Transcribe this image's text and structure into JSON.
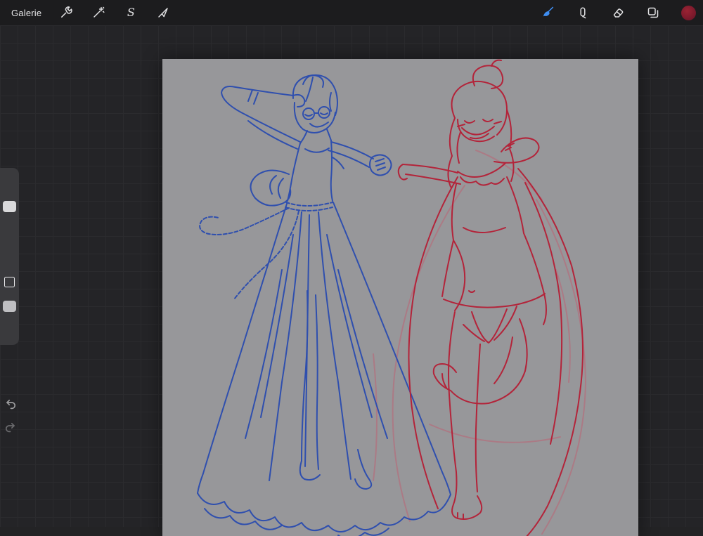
{
  "topbar": {
    "gallery_label": "Galerie",
    "tools_left": [
      {
        "name": "actions",
        "icon": "wrench-icon"
      },
      {
        "name": "adjustments",
        "icon": "magic-wand-icon"
      },
      {
        "name": "selection",
        "icon": "selection-s-icon",
        "glyph": "S"
      },
      {
        "name": "transform",
        "icon": "transform-arrow-icon"
      }
    ],
    "tools_right": [
      {
        "name": "paint",
        "icon": "brush-icon",
        "active": true
      },
      {
        "name": "smudge",
        "icon": "smudge-icon"
      },
      {
        "name": "erase",
        "icon": "eraser-icon"
      },
      {
        "name": "layers",
        "icon": "layers-icon"
      },
      {
        "name": "color",
        "icon": "color-swatch",
        "swatch_color": "#8a1c2b"
      }
    ],
    "colors": {
      "bar_bg": "#1c1c1e",
      "icon": "#e2e2e4",
      "active_icon": "#3f8ef2"
    }
  },
  "sidebar": {
    "sliders": [
      {
        "name": "brush-size-slider"
      },
      {
        "name": "opacity-slider"
      }
    ],
    "modify_button": true,
    "undo": true,
    "redo": true
  },
  "workspace": {
    "grid_bg": "#242427",
    "grid_line": "#2b2b2e",
    "canvas_bg": "#97979a",
    "sketch": {
      "blue_stroke": "#2f4fae",
      "red_stroke": "#b3243a",
      "faint_red_stroke": "#c4586c",
      "description": "Line sketch of two dancing women holding hands: left figure in blue with glasses, bun and long flowing layered dress with braided rope belt; right figure in red with messy top bun, flowing cape, two-piece outfit, one leg raised, barefoot"
    }
  }
}
